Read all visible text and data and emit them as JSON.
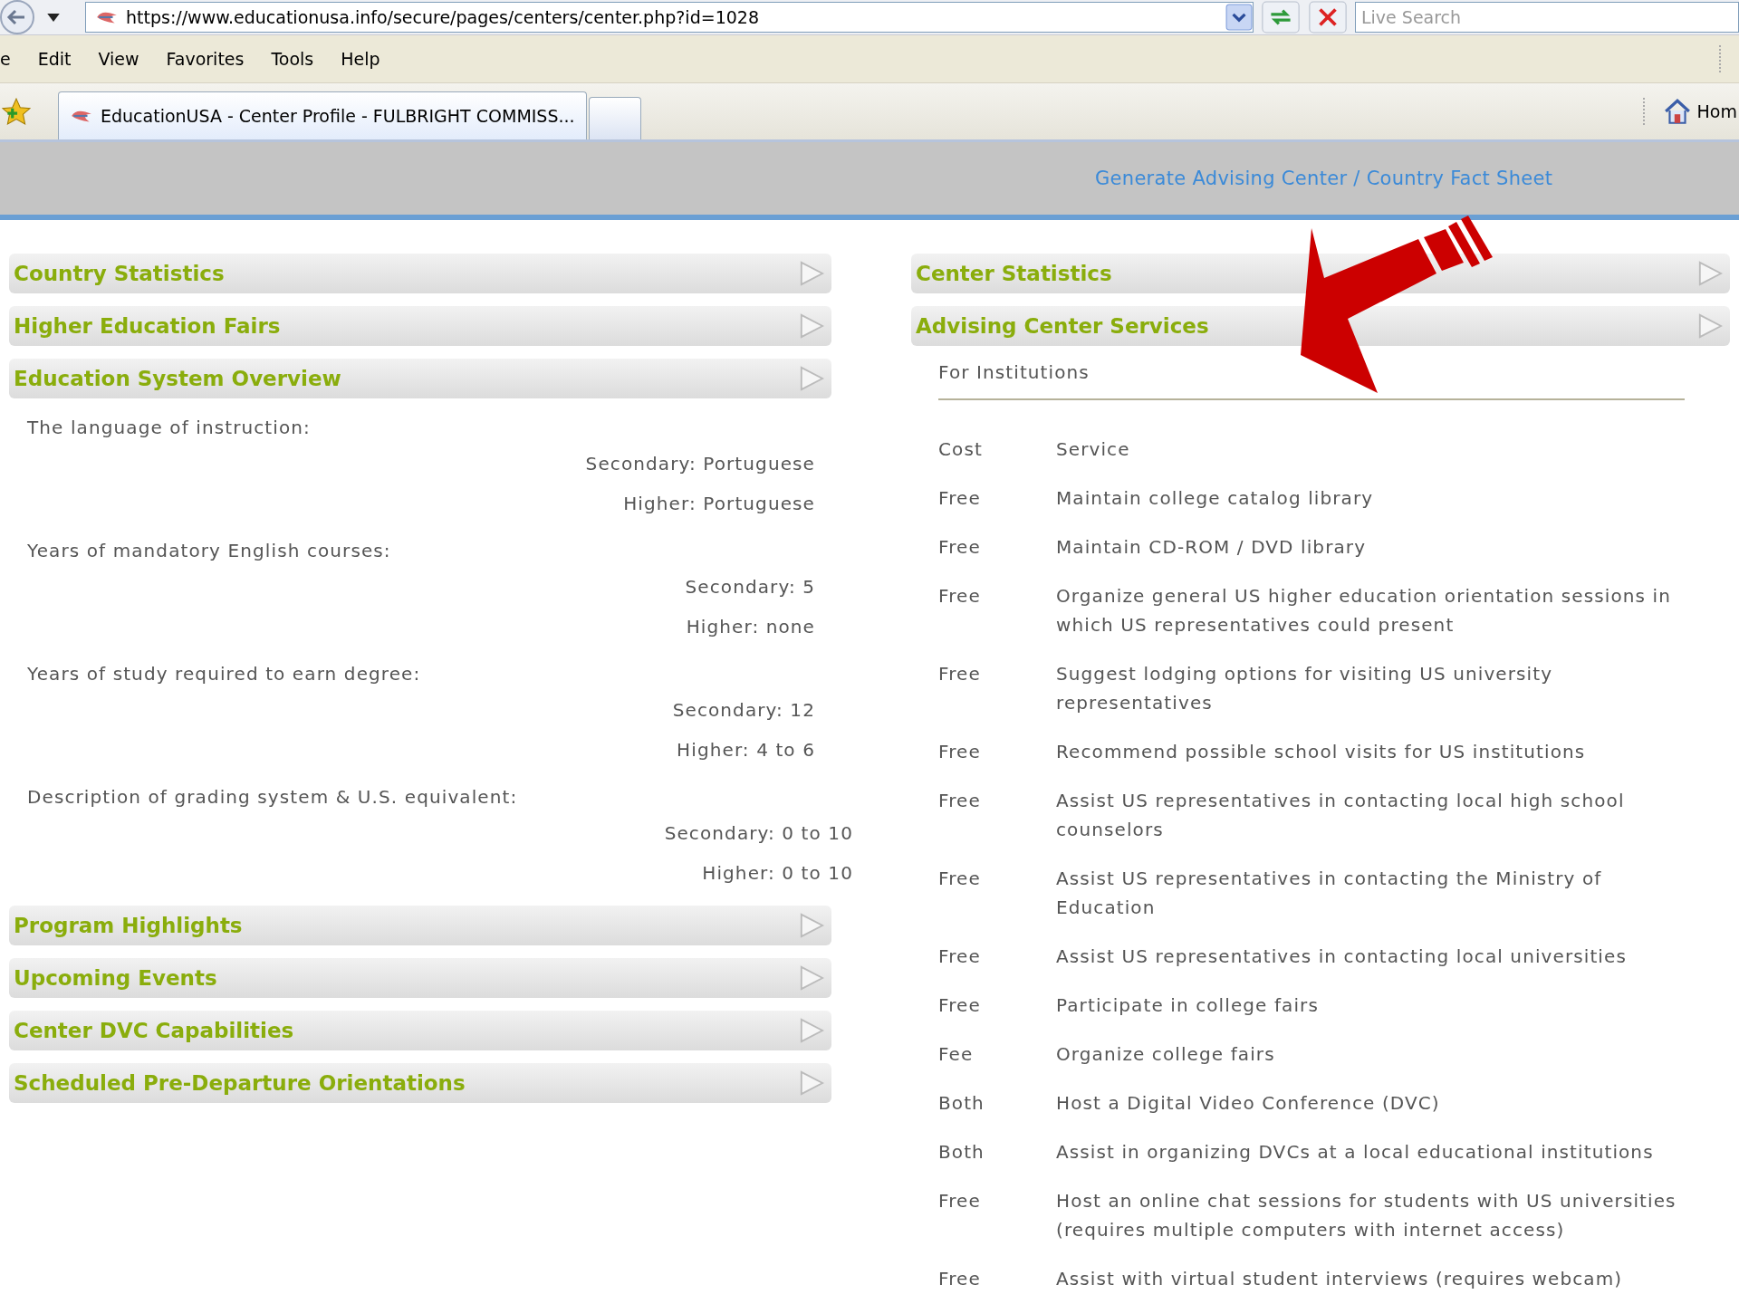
{
  "browser": {
    "url": "https://www.educationusa.info/secure/pages/centers/center.php?id=1028",
    "search": {
      "placeholder": "Live Search"
    },
    "menu": [
      "e",
      "Edit",
      "View",
      "Favorites",
      "Tools",
      "Help"
    ],
    "tabs": [
      {
        "title": "EducationUSA - Center Profile - FULBRIGHT COMMISS...",
        "selected": true
      }
    ],
    "home": "Hom"
  },
  "header": {
    "link": "Generate Advising Center / Country Fact Sheet"
  },
  "left_sections": [
    {
      "title": "Country Statistics"
    },
    {
      "title": "Higher Education Fairs"
    },
    {
      "title": "Education System Overview",
      "items": [
        {
          "label": "The language of instruction:",
          "values": [
            "Secondary: Portuguese",
            "Higher: Portuguese"
          ]
        },
        {
          "label": "Years of mandatory English courses:",
          "values": [
            "Secondary: 5",
            "Higher: none"
          ]
        },
        {
          "label": "Years of study required to earn degree:",
          "values": [
            "Secondary: 12",
            "Higher: 4 to 6"
          ]
        },
        {
          "label": "Description of grading system & U.S. equivalent:",
          "values": [
            "Secondary: 0 to 10",
            "Higher: 0 to 10"
          ]
        }
      ]
    },
    {
      "title": "Program Highlights"
    },
    {
      "title": "Upcoming Events"
    },
    {
      "title": "Center DVC Capabilities"
    },
    {
      "title": "Scheduled Pre-Departure Orientations"
    }
  ],
  "right_sections": [
    {
      "title": "Center Statistics"
    },
    {
      "title": "Advising Center Services",
      "subtitle": "For Institutions",
      "columns": [
        "Cost",
        "Service"
      ],
      "rows": [
        [
          "Free",
          "Maintain college catalog library"
        ],
        [
          "Free",
          "Maintain CD-ROM / DVD library"
        ],
        [
          "Free",
          "Organize general US higher education orientation sessions in which US representatives could present"
        ],
        [
          "Free",
          "Suggest lodging options for visiting US university representatives"
        ],
        [
          "Free",
          "Recommend possible school visits for US institutions"
        ],
        [
          "Free",
          "Assist US representatives in contacting local high school counselors"
        ],
        [
          "Free",
          "Assist US representatives in contacting the Ministry of Education"
        ],
        [
          "Free",
          "Assist US representatives in contacting local universities"
        ],
        [
          "Free",
          "Participate in college fairs"
        ],
        [
          "Fee",
          "Organize college fairs"
        ],
        [
          "Both",
          "Host a Digital Video Conference (DVC)"
        ],
        [
          "Both",
          "Assist in organizing DVCs at a local educational institutions"
        ],
        [
          "Free",
          "Host an online chat sessions for students with US universities (requires multiple computers with internet access)"
        ],
        [
          "Free",
          "Assist with virtual student interviews (requires webcam)"
        ]
      ]
    }
  ]
}
